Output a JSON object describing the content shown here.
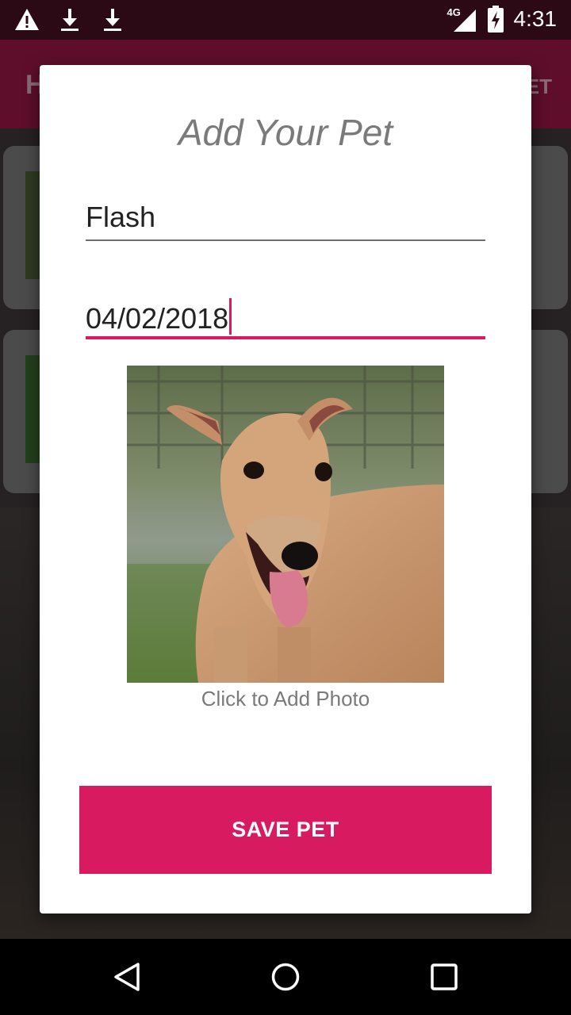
{
  "status_bar": {
    "time": "4:31",
    "network": "4G",
    "icons": [
      "warning-icon",
      "download-icon",
      "download-icon",
      "signal-icon",
      "battery-charging-icon"
    ]
  },
  "background": {
    "toolbar_title": "H",
    "toolbar_action": "ET"
  },
  "dialog": {
    "title": "Add Your Pet",
    "name_value": "Flash",
    "date_value": "04/02/2018",
    "photo_caption": "Click to Add Photo",
    "save_label": "SAVE PET"
  },
  "colors": {
    "accent": "#d81b60",
    "primary_dark": "#5e0e2a",
    "dialog_bg": "#ffffff",
    "hint_text": "#7a7a7a"
  },
  "nav_bar": {
    "icons": [
      "back-icon",
      "home-icon",
      "recents-icon"
    ]
  }
}
